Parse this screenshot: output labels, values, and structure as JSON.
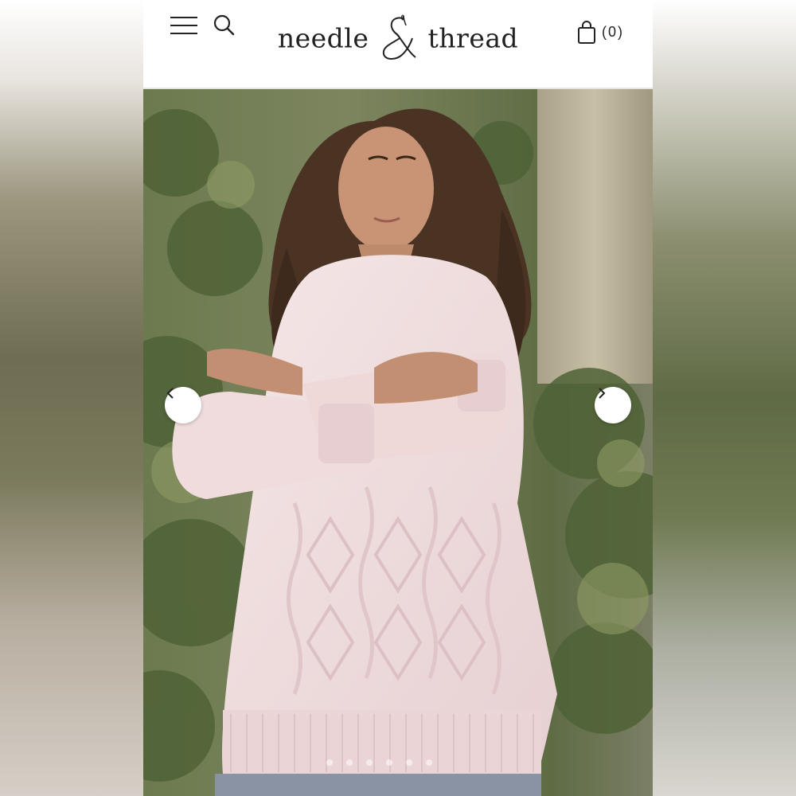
{
  "header": {
    "logo": {
      "left_word": "needle",
      "right_word": "thread",
      "ampersand": "&"
    },
    "cart_count": "(0)",
    "icons": {
      "menu": "hamburger-menu-icon",
      "search": "search-icon",
      "cart": "shopping-bag-icon"
    }
  },
  "gallery": {
    "image": "woman-in-pink-cable-knit-sweater-photo",
    "prev_icon": "chevron-left-icon",
    "next_icon": "chevron-right-icon",
    "dot_count": 6
  },
  "colors": {
    "sweater": "#efdede",
    "foliage": "#6f7a55",
    "header_bg": "#ffffff",
    "text": "#222222"
  }
}
